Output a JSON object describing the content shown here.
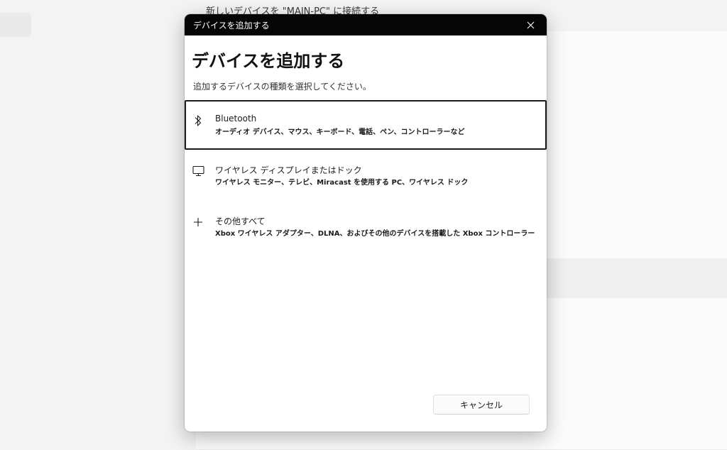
{
  "background": {
    "caption": "新しいデバイスを \"MAIN-PC\" に接続する"
  },
  "dialog": {
    "window_title": "デバイスを追加する",
    "heading": "デバイスを追加する",
    "subtitle": "追加するデバイスの種類を選択してください。",
    "options": [
      {
        "icon": "bluetooth-icon",
        "title": "Bluetooth",
        "description": "オーディオ デバイス、マウス、キーボード、電話、ペン、コントローラーなど",
        "selected": true
      },
      {
        "icon": "monitor-icon",
        "title": "ワイヤレス ディスプレイまたはドック",
        "description": "ワイヤレス モニター、テレビ、Miracast を使用する PC、ワイヤレス ドック",
        "selected": false
      },
      {
        "icon": "plus-icon",
        "title": "その他すべて",
        "description": "Xbox ワイヤレス アダプター、DLNA、およびその他のデバイスを搭載した Xbox コントローラー",
        "selected": false
      }
    ],
    "cancel_label": "キャンセル"
  },
  "colors": {
    "titlebar": "#050505",
    "dialog_bg": "#ffffff",
    "selected_border": "#1a1a1a",
    "page_bg": "#f3f3f3"
  }
}
